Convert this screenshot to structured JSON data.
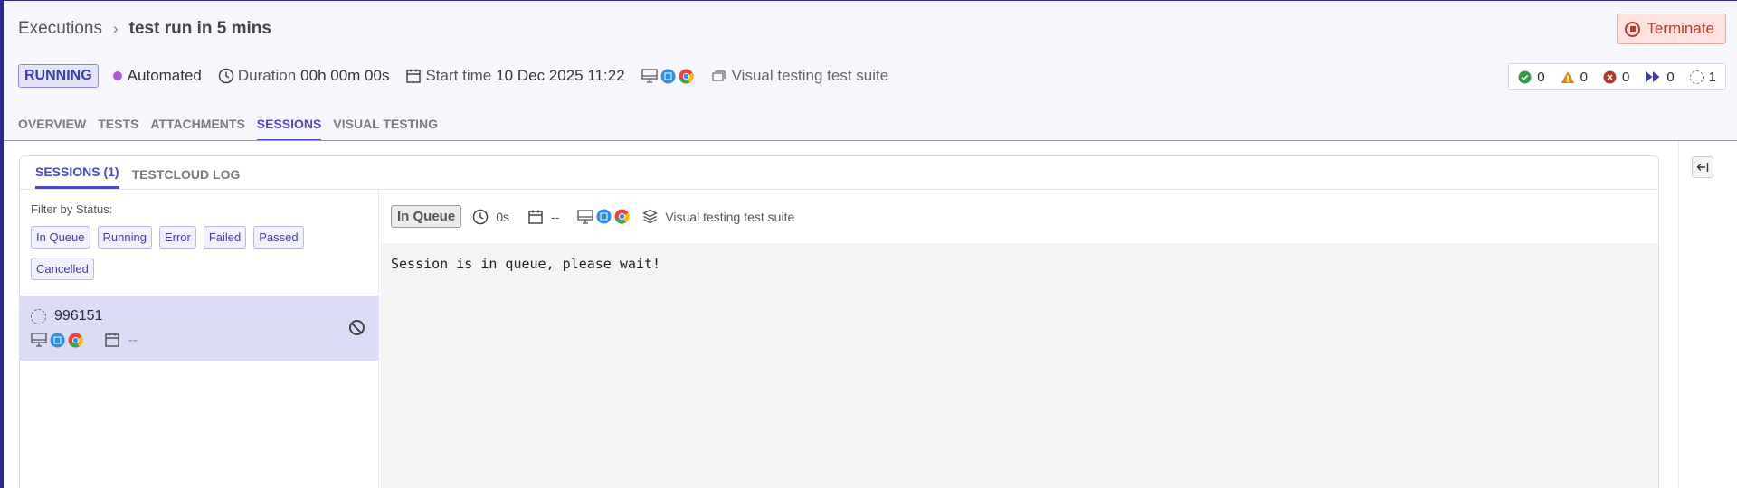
{
  "breadcrumb": {
    "parent": "Executions",
    "separator": "›",
    "current": "test run in 5 mins"
  },
  "actions": {
    "terminate_label": "Terminate"
  },
  "meta": {
    "status": "RUNNING",
    "mode": "Automated",
    "duration_label": "Duration",
    "duration_value": "00h 00m 00s",
    "start_label": "Start time",
    "start_value": "10 Dec 2025 11:22",
    "suite": "Visual testing test suite"
  },
  "counts": {
    "passed": "0",
    "warning": "0",
    "failed": "0",
    "skipped": "0",
    "queued": "1"
  },
  "tabs": [
    "OVERVIEW",
    "TESTS",
    "ATTACHMENTS",
    "SESSIONS",
    "VISUAL TESTING"
  ],
  "inner_tabs": [
    "SESSIONS (1)",
    "TESTCLOUD LOG"
  ],
  "filter": {
    "label": "Filter by Status:",
    "chips": [
      "In Queue",
      "Running",
      "Error",
      "Failed",
      "Passed",
      "Cancelled"
    ]
  },
  "session": {
    "id": "996151",
    "date": "--"
  },
  "detail": {
    "status": "In Queue",
    "duration": "0s",
    "date": "--",
    "suite": "Visual testing test suite",
    "log": "Session is in queue, please wait!"
  },
  "colors": {
    "accent": "#4a4ac7",
    "terminate": "#c0392b",
    "selected_row": "#dcdcf7"
  }
}
